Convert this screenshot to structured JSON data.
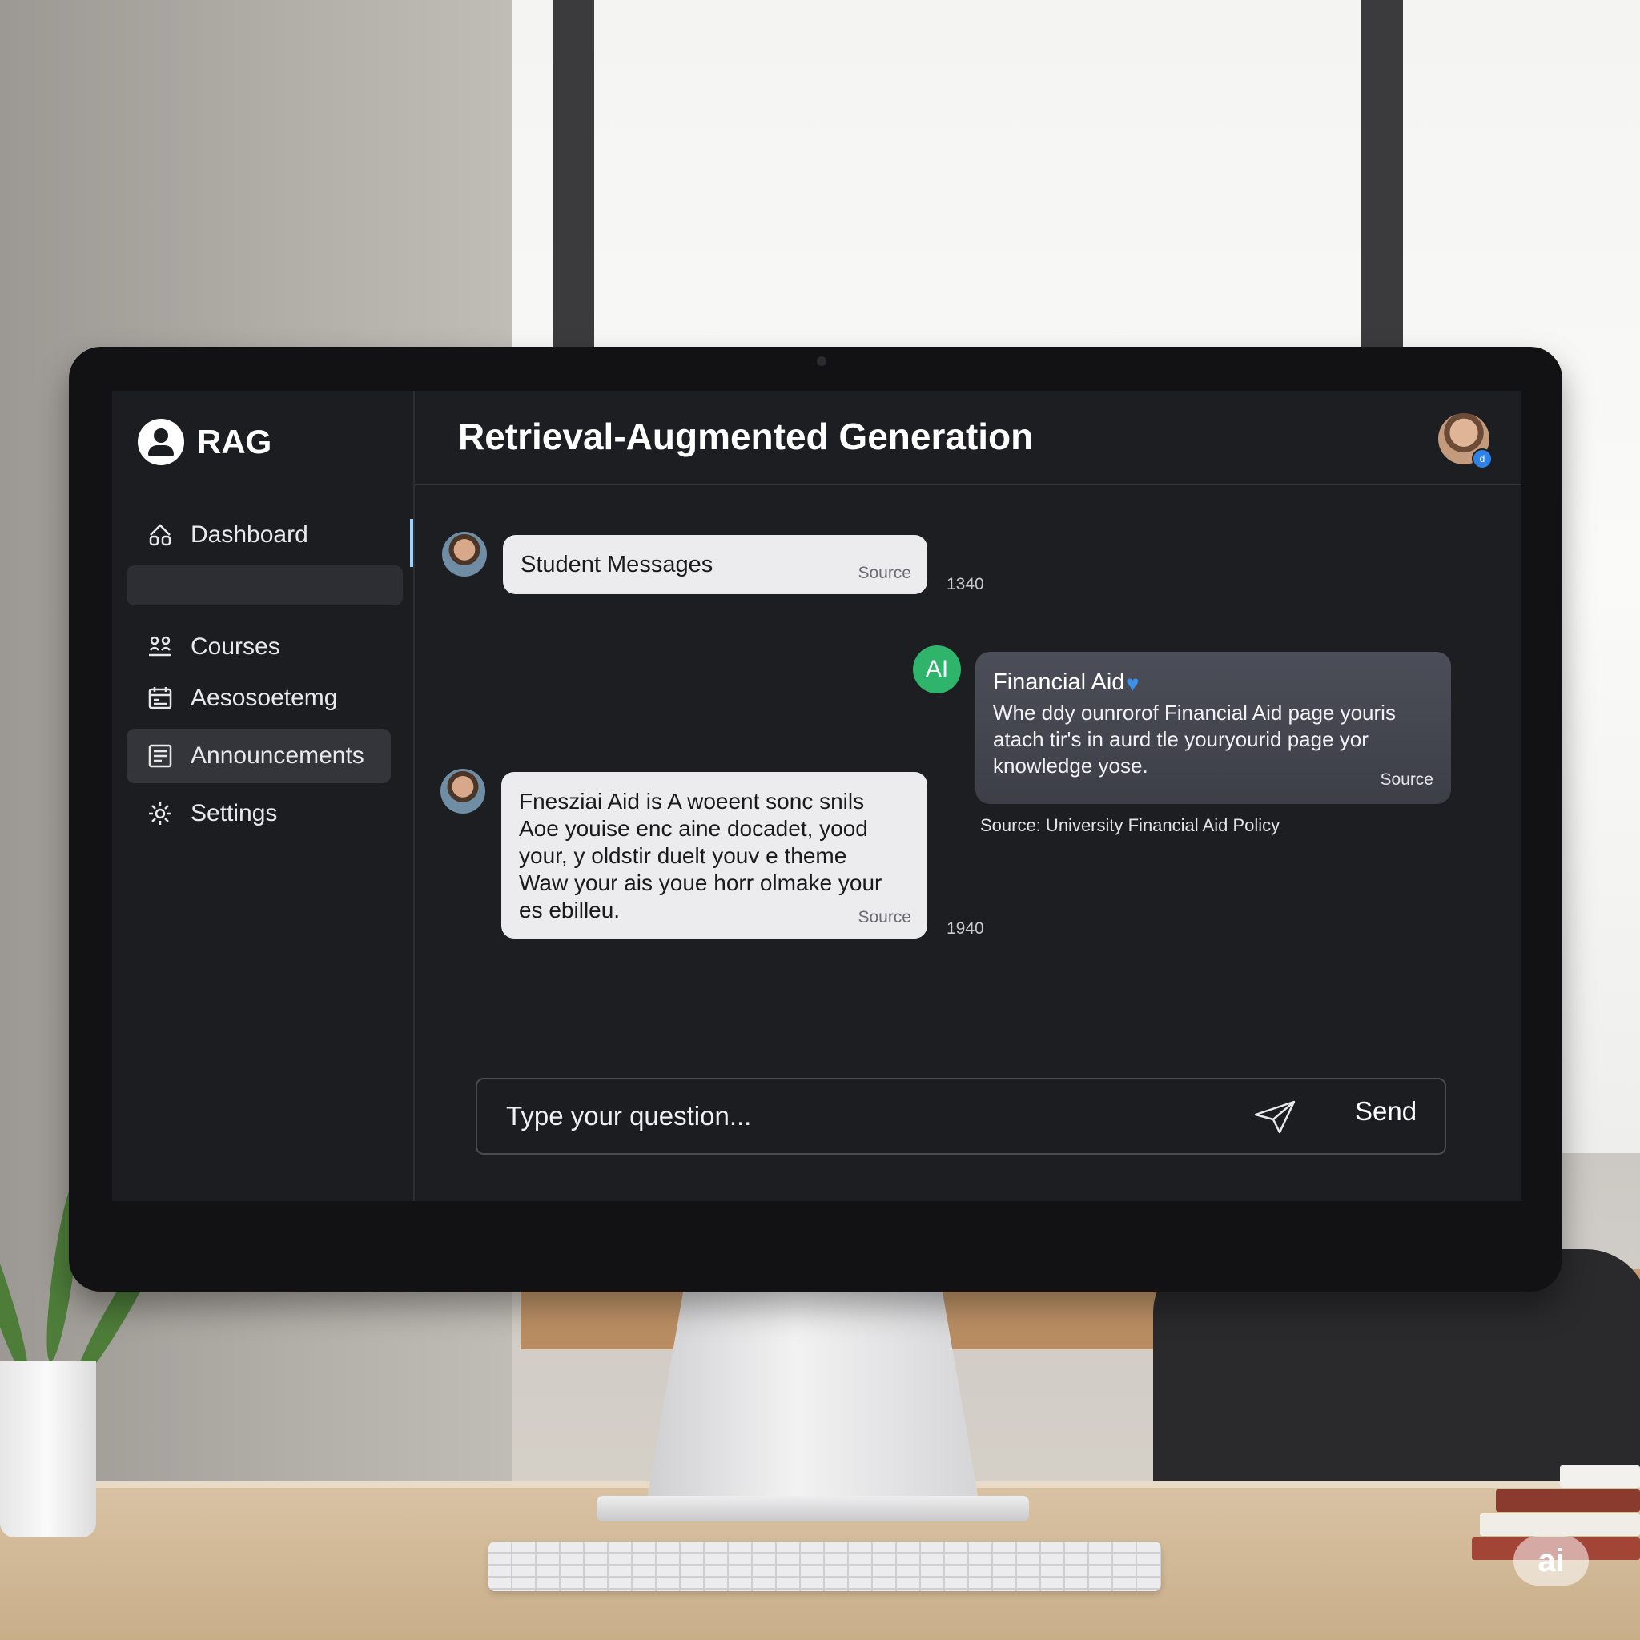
{
  "app": {
    "name": "RAG"
  },
  "sidebar": {
    "items": [
      {
        "label": "Dashboard",
        "icon": "home-icon",
        "active": false
      },
      {
        "label": "Courses",
        "icon": "people-icon",
        "active": false
      },
      {
        "label": "Aesosoetemg",
        "icon": "calendar-icon",
        "active": false
      },
      {
        "label": "Announcements",
        "icon": "list-icon",
        "active": true
      },
      {
        "label": "Settings",
        "icon": "gear-icon",
        "active": false
      }
    ]
  },
  "header": {
    "title": "Retrieval-Augmented Generation",
    "avatar_badge": "d"
  },
  "chat": {
    "messages": [
      {
        "sender": "student",
        "text": "Student Messages",
        "source_label": "Source",
        "time": "1340"
      },
      {
        "sender": "ai",
        "avatar_label": "AI",
        "title": "Financial Aid",
        "text": "Whe ddy ounrorof Financial Aid page youris atach tir's in aurd tle youryourid page yor knowledge yose.",
        "source_label": "Source",
        "source_note": "Source: University Financial Aid Policy"
      },
      {
        "sender": "student",
        "text": "Fnesziai Aid is A woeent sonc snils Aoe youise enc aine docadet, yood your, y oldstir duelt youv e theme Waw your ais youe horr olmake your es ebilleu.",
        "source_label": "Source",
        "time": "1940"
      }
    ]
  },
  "composer": {
    "placeholder": "Type your question...",
    "send_label": "Send"
  },
  "watermark": {
    "text": "ai"
  },
  "colors": {
    "screen_bg": "#1d1e22",
    "ai_green": "#2fb56b",
    "accent_blue": "#3c8fe6",
    "bubble_light": "#ececee"
  }
}
